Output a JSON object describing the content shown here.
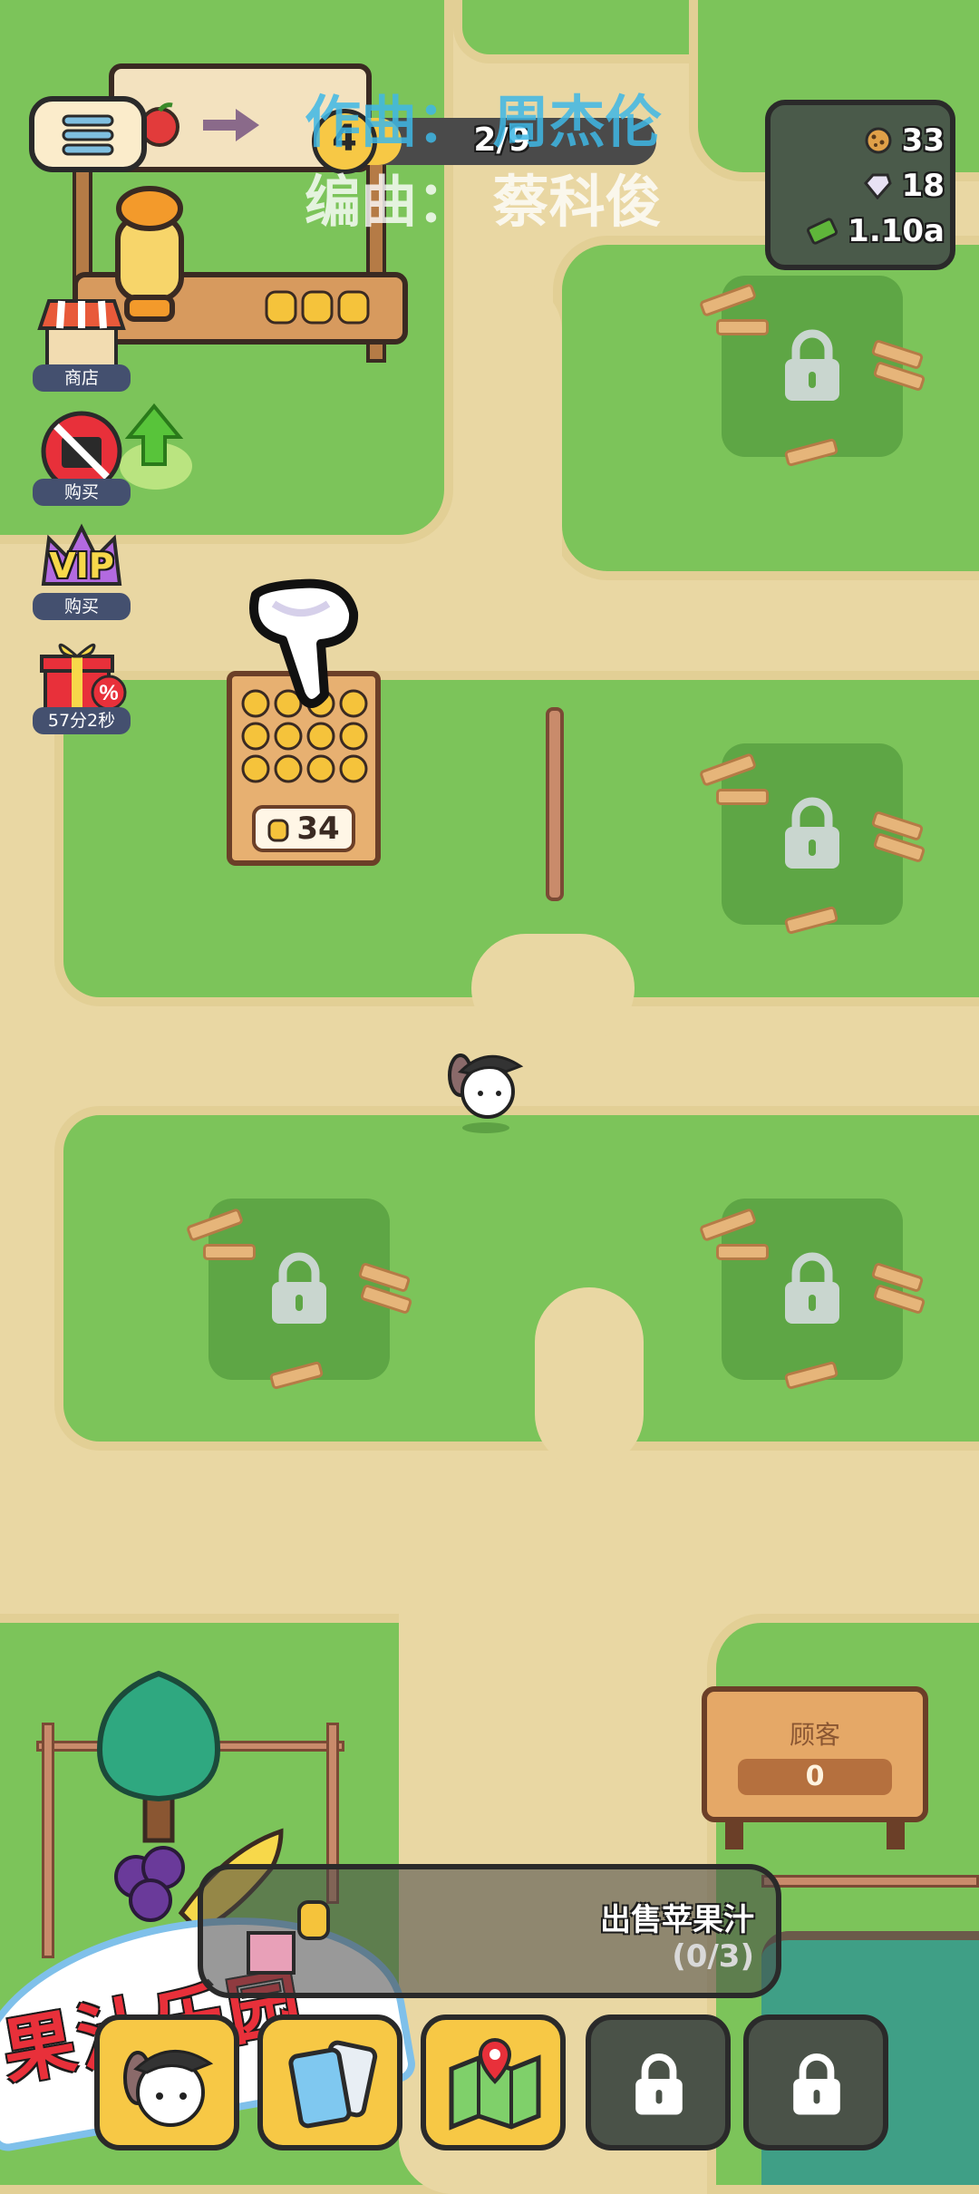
{
  "watermark": {
    "composer": "作曲： 周杰伦",
    "lyricist": "编曲： 蔡科俊"
  },
  "hud": {
    "level": "4",
    "progress_text": "2/9",
    "progress_fraction": 0.22,
    "resources": [
      {
        "icon": "cookie-icon",
        "value": "33"
      },
      {
        "icon": "gem-icon",
        "value": "18"
      },
      {
        "icon": "cash-icon",
        "value": "1.10a"
      }
    ]
  },
  "side_menu": [
    {
      "name": "shop",
      "label": "商店"
    },
    {
      "name": "no-ads",
      "label": "购买"
    },
    {
      "name": "vip",
      "label": "购买",
      "badge": "VIP"
    },
    {
      "name": "gift",
      "label": "57分2秒"
    }
  ],
  "juice_crate": {
    "count": "34"
  },
  "customer_board": {
    "title": "顾客",
    "count": "0"
  },
  "quest": {
    "title": "出售苹果汁",
    "progress": "(0/3)"
  },
  "sign_text": "果汁乐园",
  "bottom_nav": [
    {
      "name": "character",
      "locked": false
    },
    {
      "name": "cards",
      "locked": false
    },
    {
      "name": "map",
      "locked": false
    },
    {
      "name": "pet",
      "locked": true
    },
    {
      "name": "deck",
      "locked": true
    }
  ],
  "colors": {
    "grass": "#7cc45a",
    "path": "#e9d7a3",
    "plot": "#5ea645",
    "watermark_blue": "#3fb8e6"
  }
}
